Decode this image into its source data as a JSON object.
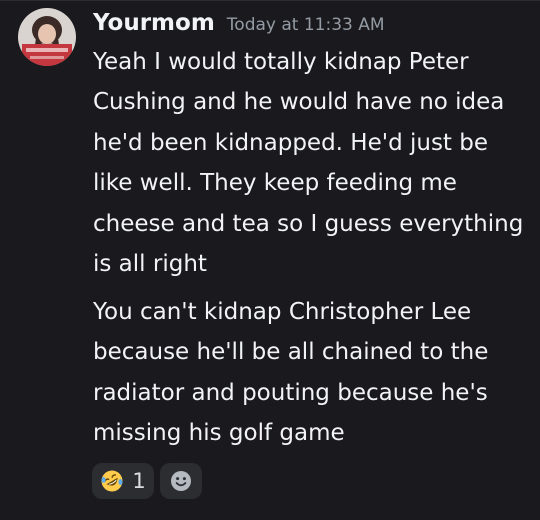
{
  "message": {
    "author": "Yourmom",
    "timestamp": "Today at 11:33 AM",
    "avatar_icon": "profile-avatar",
    "lines": [
      "Yeah I would totally kidnap Peter Cushing and he would have no idea he'd been kidnapped. He'd just be like well. They keep feeding me cheese and tea so I guess everything is all right",
      "You can't kidnap Christopher Lee because he'll be all chained to the radiator and pouting because he's missing his golf game"
    ]
  },
  "reactions": [
    {
      "emoji_icon": "rolling-on-floor-laughing-emoji",
      "count": "1"
    }
  ],
  "add_reaction_icon": "smiley-add-reaction-icon",
  "colors": {
    "background": "#1a1a1e",
    "text": "#f2f3f5",
    "muted": "#949ba4",
    "pill": "#2b2d31"
  }
}
